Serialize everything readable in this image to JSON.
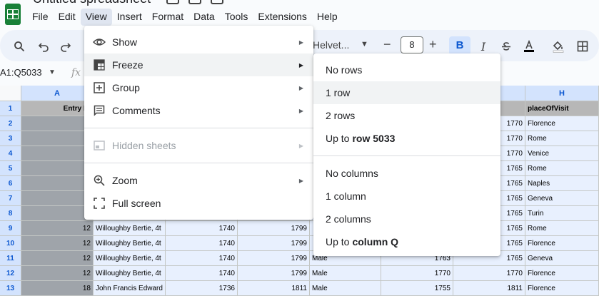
{
  "app": {
    "title": "Untitled spreadsheet"
  },
  "menubar": [
    "File",
    "Edit",
    "View",
    "Insert",
    "Format",
    "Data",
    "Tools",
    "Extensions",
    "Help"
  ],
  "toolbar": {
    "font": "Helvet...",
    "font_size": "8",
    "bold": "B",
    "italic": "I"
  },
  "formula_bar": {
    "name_box": "A1:Q5033",
    "fx": "fx"
  },
  "grid": {
    "columns": [
      {
        "id": "A",
        "label": "A"
      },
      {
        "id": "H",
        "label": "H"
      }
    ],
    "rows": [
      {
        "num": "1",
        "a": "Entry ID",
        "b": "",
        "c": "",
        "d": "",
        "e": "",
        "f": "",
        "g": "",
        "h": "placeOfVisit"
      },
      {
        "num": "2",
        "a": "",
        "b": "",
        "c": "",
        "d": "",
        "e": "",
        "f": "",
        "g": "1770",
        "h": "Florence"
      },
      {
        "num": "3",
        "a": "",
        "b": "",
        "c": "",
        "d": "",
        "e": "",
        "f": "",
        "g": "1770",
        "h": "Rome"
      },
      {
        "num": "4",
        "a": "",
        "b": "",
        "c": "",
        "d": "",
        "e": "",
        "f": "",
        "g": "1770",
        "h": "Venice"
      },
      {
        "num": "5",
        "a": "",
        "b": "",
        "c": "",
        "d": "",
        "e": "",
        "f": "",
        "g": "1765",
        "h": "Rome"
      },
      {
        "num": "6",
        "a": "",
        "b": "",
        "c": "",
        "d": "",
        "e": "",
        "f": "",
        "g": "1765",
        "h": "Naples"
      },
      {
        "num": "7",
        "a": "",
        "b": "",
        "c": "",
        "d": "",
        "e": "",
        "f": "",
        "g": "1765",
        "h": "Geneva"
      },
      {
        "num": "8",
        "a": "",
        "b": "",
        "c": "",
        "d": "",
        "e": "",
        "f": "",
        "g": "1765",
        "h": "Turin"
      },
      {
        "num": "9",
        "a": "12",
        "b": "Willoughby Bertie, 4t",
        "c": "1740",
        "d": "1799",
        "e": "",
        "f": "",
        "g": "1765",
        "h": "Rome"
      },
      {
        "num": "10",
        "a": "12",
        "b": "Willoughby Bertie, 4t",
        "c": "1740",
        "d": "1799",
        "e": "",
        "f": "",
        "g": "1765",
        "h": "Florence"
      },
      {
        "num": "11",
        "a": "12",
        "b": "Willoughby Bertie, 4t",
        "c": "1740",
        "d": "1799",
        "e": "Male",
        "f": "1763",
        "g": "1765",
        "h": "Geneva"
      },
      {
        "num": "12",
        "a": "12",
        "b": "Willoughby Bertie, 4t",
        "c": "1740",
        "d": "1799",
        "e": "Male",
        "f": "1770",
        "g": "1770",
        "h": "Florence"
      },
      {
        "num": "13",
        "a": "18",
        "b": "John Francis Edward",
        "c": "1736",
        "d": "1811",
        "e": "Male",
        "f": "1755",
        "g": "1811",
        "h": "Florence"
      }
    ]
  },
  "view_menu": {
    "items": [
      {
        "label": "Show",
        "icon": "eye-icon",
        "submenu": true
      },
      {
        "label": "Freeze",
        "icon": "freeze-icon",
        "submenu": true
      },
      {
        "label": "Group",
        "icon": "group-icon",
        "submenu": true
      },
      {
        "label": "Comments",
        "icon": "comments-icon",
        "submenu": true
      },
      {
        "label": "Hidden sheets",
        "icon": "hidden-sheets-icon",
        "submenu": true
      },
      {
        "label": "Zoom",
        "icon": "zoom-icon",
        "submenu": true
      },
      {
        "label": "Full screen",
        "icon": "fullscreen-icon",
        "submenu": false
      }
    ]
  },
  "freeze_menu": {
    "no_rows": "No rows",
    "one_row": "1 row",
    "two_rows": "2 rows",
    "up_to_row_prefix": "Up to",
    "up_to_row_value": "row 5033",
    "no_columns": "No columns",
    "one_column": "1 column",
    "two_columns": "2 columns",
    "up_to_column_prefix": "Up to",
    "up_to_column_value": "column Q"
  },
  "colors": {
    "accent": "#0b57d0",
    "selection": "#e8f0fe",
    "header_fill": "#b7b7b7"
  }
}
